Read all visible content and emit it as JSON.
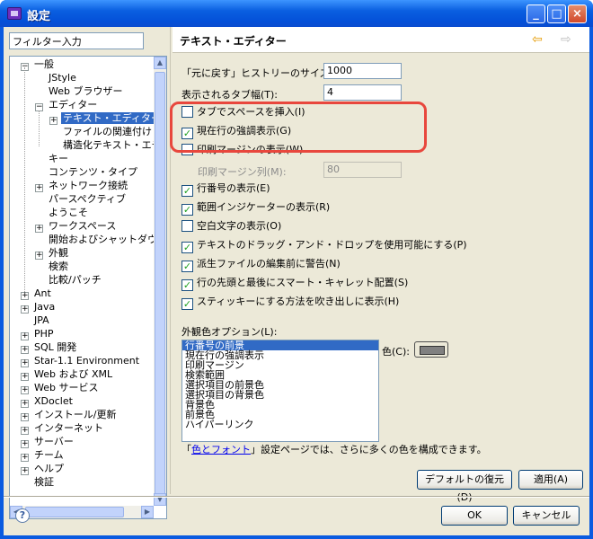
{
  "window": {
    "title": "設定",
    "minimize": "_",
    "maximize": "□",
    "close": "×"
  },
  "filter": {
    "value": "フィルター入力"
  },
  "tree": {
    "items": [
      {
        "label": "一般",
        "depth": 0,
        "exp": "−"
      },
      {
        "label": "JStyle",
        "depth": 1
      },
      {
        "label": "Web ブラウザー",
        "depth": 1
      },
      {
        "label": "エディター",
        "depth": 1,
        "exp": "−"
      },
      {
        "label": "テキスト・エディター",
        "depth": 2,
        "exp": "+",
        "selected": true
      },
      {
        "label": "ファイルの関連付け",
        "depth": 2
      },
      {
        "label": "構造化テキスト・エディ",
        "depth": 2
      },
      {
        "label": "キー",
        "depth": 1
      },
      {
        "label": "コンテンツ・タイプ",
        "depth": 1
      },
      {
        "label": "ネットワーク接続",
        "depth": 1,
        "exp": "+"
      },
      {
        "label": "パースペクティブ",
        "depth": 1
      },
      {
        "label": "ようこそ",
        "depth": 1
      },
      {
        "label": "ワークスペース",
        "depth": 1,
        "exp": "+"
      },
      {
        "label": "開始およびシャットダウン",
        "depth": 1
      },
      {
        "label": "外観",
        "depth": 1,
        "exp": "+"
      },
      {
        "label": "検索",
        "depth": 1
      },
      {
        "label": "比較/パッチ",
        "depth": 1
      },
      {
        "label": "Ant",
        "depth": 0,
        "exp": "+"
      },
      {
        "label": "Java",
        "depth": 0,
        "exp": "+"
      },
      {
        "label": "JPA",
        "depth": 0
      },
      {
        "label": "PHP",
        "depth": 0,
        "exp": "+"
      },
      {
        "label": "SQL 開発",
        "depth": 0,
        "exp": "+"
      },
      {
        "label": "Star-1.1 Environment",
        "depth": 0,
        "exp": "+"
      },
      {
        "label": "Web および XML",
        "depth": 0,
        "exp": "+"
      },
      {
        "label": "Web サービス",
        "depth": 0,
        "exp": "+"
      },
      {
        "label": "XDoclet",
        "depth": 0,
        "exp": "+"
      },
      {
        "label": "インストール/更新",
        "depth": 0,
        "exp": "+"
      },
      {
        "label": "インターネット",
        "depth": 0,
        "exp": "+"
      },
      {
        "label": "サーバー",
        "depth": 0,
        "exp": "+"
      },
      {
        "label": "チーム",
        "depth": 0,
        "exp": "+"
      },
      {
        "label": "ヘルプ",
        "depth": 0,
        "exp": "+"
      },
      {
        "label": "検証",
        "depth": 0
      }
    ]
  },
  "page": {
    "title": "テキスト・エディター",
    "back": "⇦",
    "forward": "⇨",
    "undo_history": {
      "label": "「元に戻す」ヒストリーのサイズ(U):",
      "value": "1000"
    },
    "tab_width": {
      "label": "表示されるタブ幅(T):",
      "value": "4"
    },
    "insert_spaces": {
      "label": "タブでスペースを挿入(I)",
      "checked": false
    },
    "highlight_line": {
      "label": "現在行の強調表示(G)",
      "checked": true
    },
    "print_margin": {
      "label": "印刷マージンの表示(W)",
      "checked": false
    },
    "print_margin_col": {
      "label": "印刷マージン列(M):",
      "value": "80"
    },
    "options": [
      {
        "label": "行番号の表示(E)",
        "checked": true
      },
      {
        "label": "範囲インジケーターの表示(R)",
        "checked": true
      },
      {
        "label": "空白文字の表示(O)",
        "checked": false
      },
      {
        "label": "テキストのドラッグ・アンド・ドロップを使用可能にする(P)",
        "checked": true
      },
      {
        "label": "派生ファイルの編集前に警告(N)",
        "checked": true
      },
      {
        "label": "行の先頭と最後にスマート・キャレット配置(S)",
        "checked": true
      },
      {
        "label": "スティッキーにする方法を吹き出しに表示(H)",
        "checked": true
      }
    ],
    "appearance": {
      "label": "外観色オプション(L):",
      "items": [
        "行番号の前景",
        "現在行の強調表示",
        "印刷マージン",
        "検索範囲",
        "選択項目の前景色",
        "選択項目の背景色",
        "背景色",
        "前景色",
        "ハイパーリンク"
      ],
      "color_label": "色(C):",
      "color_value": "#808080"
    },
    "hint_prefix": "「",
    "hint_link": "色とフォント",
    "hint_suffix": "」設定ページでは、さらに多くの色を構成できます。",
    "restore_defaults": "デフォルトの復元(D)",
    "apply": "適用(A)"
  },
  "footer": {
    "help": "?",
    "ok": "OK",
    "cancel": "キャンセル"
  }
}
